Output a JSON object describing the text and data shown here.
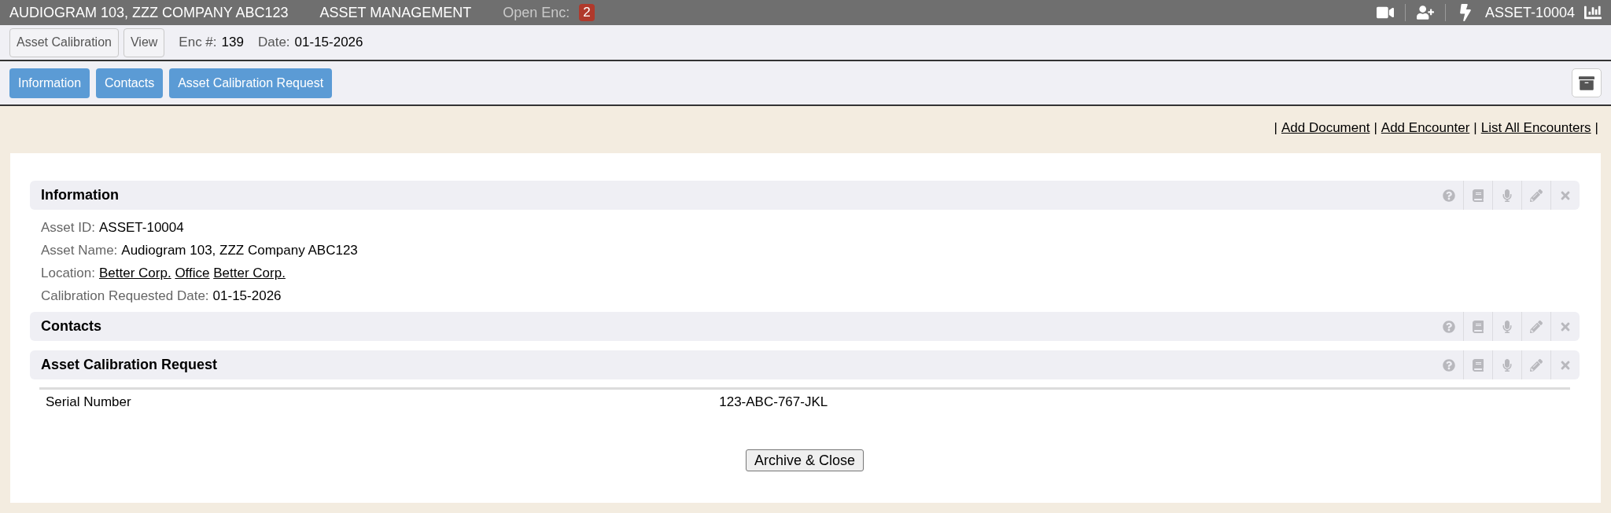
{
  "top_bar": {
    "title": "AUDIOGRAM 103, ZZZ COMPANY ABC123",
    "module": "ASSET MANAGEMENT",
    "open_enc_label": "Open Enc:",
    "open_enc_count": "2",
    "asset_id": "ASSET-10004"
  },
  "sub_bar": {
    "buttons": [
      "Asset Calibration",
      "View"
    ],
    "info": [
      {
        "label": "Enc #:",
        "value": "139"
      },
      {
        "label": "Date:",
        "value": "01-15-2026"
      }
    ]
  },
  "tabs": [
    "Information",
    "Contacts",
    "Asset Calibration Request"
  ],
  "links": {
    "separator": "|",
    "items": [
      "Add Document",
      "Add Encounter",
      "List All Encounters"
    ]
  },
  "sections": [
    {
      "title": "Information",
      "fields": [
        {
          "kind": "text",
          "label": "Asset ID:",
          "value": "ASSET-10004"
        },
        {
          "kind": "text",
          "label": "Asset Name:",
          "value": "Audiogram 103, ZZZ Company ABC123"
        },
        {
          "kind": "links",
          "label": "Location:",
          "links": [
            "Better Corp.",
            "Office",
            "Better Corp."
          ]
        },
        {
          "kind": "text",
          "label": "Calibration Requested Date:",
          "value": "01-15-2026"
        }
      ]
    },
    {
      "title": "Contacts"
    },
    {
      "title": "Asset Calibration Request",
      "table": [
        {
          "cells": [
            "Serial Number",
            "123-ABC-767-JKL"
          ]
        }
      ]
    }
  ],
  "footer_button": "Archive & Close"
}
